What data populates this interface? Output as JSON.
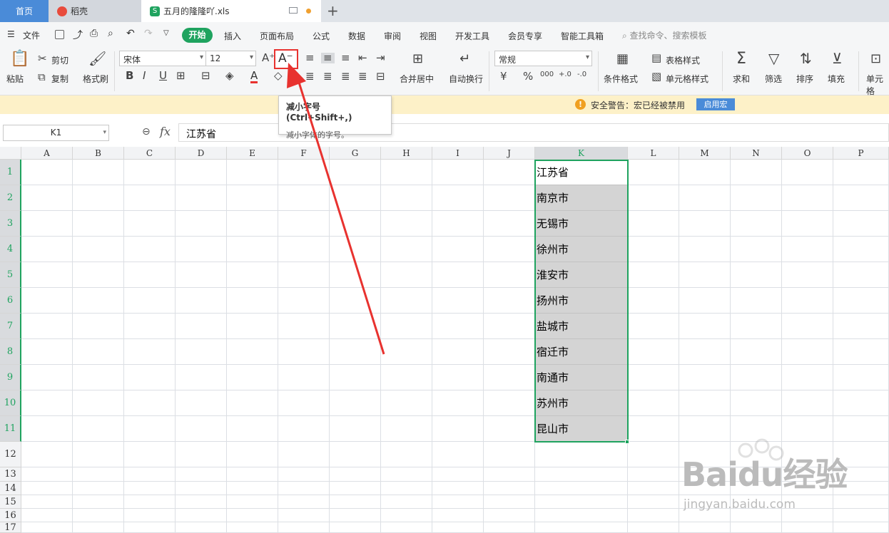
{
  "tabs": [
    {
      "label": "首页"
    },
    {
      "label": "稻壳"
    },
    {
      "label": "五月的隆隆吖.xls"
    }
  ],
  "new_tab": "+",
  "menu": {
    "file": "文件",
    "items": [
      "开始",
      "插入",
      "页面布局",
      "公式",
      "数据",
      "审阅",
      "视图",
      "开发工具",
      "会员专享",
      "智能工具箱"
    ],
    "search_placeholder": "查找命令、搜索模板"
  },
  "ribbon": {
    "paste": "粘贴",
    "cut": "剪切",
    "copy": "复制",
    "format_painter": "格式刷",
    "font_name": "宋体",
    "font_size": "12",
    "merge_center": "合并居中",
    "wrap_text": "自动换行",
    "number_format": "常规",
    "cond_format": "条件格式",
    "table_style": "表格样式",
    "cell_style": "单元格样式",
    "sum": "求和",
    "filter": "筛选",
    "sort": "排序",
    "fill": "填充",
    "cell": "单元格"
  },
  "tooltip": {
    "title": "减小字号 (Ctrl+Shift+,)",
    "desc": "减小字体的字号。"
  },
  "warning": {
    "text": "安全警告：宏已经被禁用",
    "button": "启用宏"
  },
  "formula": {
    "namebox": "K1",
    "fx": "fx",
    "value": "江苏省"
  },
  "columns": [
    "A",
    "B",
    "C",
    "D",
    "E",
    "F",
    "G",
    "H",
    "I",
    "J",
    "K",
    "L",
    "M",
    "N",
    "O",
    "P"
  ],
  "rows": [
    "1",
    "2",
    "3",
    "4",
    "5",
    "6",
    "7",
    "8",
    "9",
    "10",
    "11",
    "12",
    "13",
    "14",
    "15",
    "16",
    "17"
  ],
  "column_k": [
    "江苏省",
    "南京市",
    "无锡市",
    "徐州市",
    "淮安市",
    "扬州市",
    "盐城市",
    "宿迁市",
    "南通市",
    "苏州市",
    "昆山市"
  ],
  "watermark": {
    "text": "Baidu经验",
    "url": "jingyan.baidu.com"
  },
  "colors": {
    "accent": "#1fa35f",
    "highlight": "#e8322f",
    "home_tab": "#4a8bd8"
  }
}
